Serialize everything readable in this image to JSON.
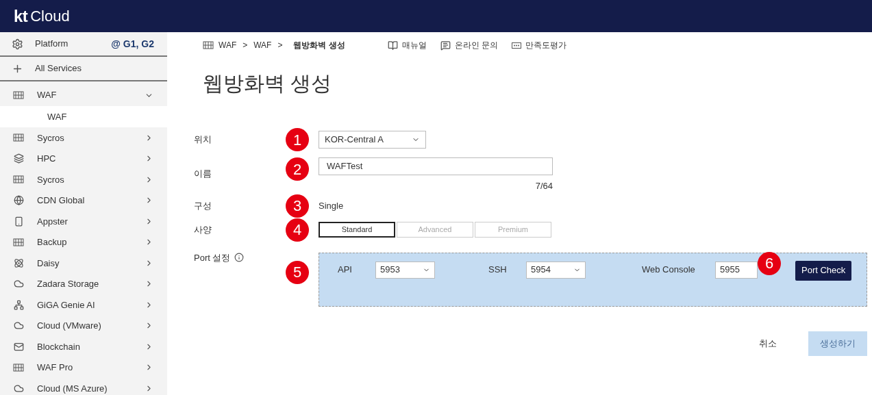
{
  "header": {
    "logo_mark": "kt",
    "logo_text": "Cloud"
  },
  "sidebar": {
    "platform": {
      "label": "Platform",
      "value": "@ G1, G2"
    },
    "all_services": "All Services",
    "items": [
      {
        "label": "WAF",
        "expanded": true,
        "children": [
          {
            "label": "WAF",
            "selected": true
          }
        ]
      },
      {
        "label": "Sycros",
        "expanded": false
      },
      {
        "label": "HPC",
        "expanded": false
      },
      {
        "label": "Sycros",
        "expanded": false
      },
      {
        "label": "CDN Global",
        "expanded": false
      },
      {
        "label": "Appster",
        "expanded": false
      },
      {
        "label": "Backup",
        "expanded": false
      },
      {
        "label": "Daisy",
        "expanded": false
      },
      {
        "label": "Zadara Storage",
        "expanded": false
      },
      {
        "label": "GiGA Genie AI",
        "expanded": false
      },
      {
        "label": "Cloud (VMware)",
        "expanded": false
      },
      {
        "label": "Blockchain",
        "expanded": false
      },
      {
        "label": "WAF Pro",
        "expanded": false
      },
      {
        "label": "Cloud (MS Azure)",
        "expanded": false
      }
    ]
  },
  "breadcrumb": [
    "WAF",
    ">",
    "WAF",
    ">",
    "웹방화벽 생성"
  ],
  "top_links": [
    "매뉴얼",
    "온라인 문의",
    "만족도평가"
  ],
  "page_title": "웹방화벽 생성",
  "form": {
    "location": {
      "label": "위치",
      "marker": "1",
      "value": "KOR-Central A"
    },
    "name": {
      "label": "이름",
      "marker": "2",
      "value": "WAFTest",
      "counter": "7/64"
    },
    "config": {
      "label": "구성",
      "marker": "3",
      "value": "Single"
    },
    "spec": {
      "label": "사양",
      "marker": "4",
      "options": [
        {
          "label": "Standard",
          "selected": true
        },
        {
          "label": "Advanced",
          "selected": false
        },
        {
          "label": "Premium",
          "selected": false
        }
      ]
    },
    "port": {
      "label": "Port 설정",
      "marker": "5",
      "fields": [
        {
          "label": "API",
          "value": "5953"
        },
        {
          "label": "SSH",
          "value": "5954"
        },
        {
          "label": "Web Console",
          "value": "5955"
        }
      ],
      "check_marker": "6",
      "check_button": "Port Check"
    }
  },
  "actions": [
    {
      "label": "취소",
      "disabled": false
    },
    {
      "label": "생성하기",
      "disabled": true
    }
  ]
}
